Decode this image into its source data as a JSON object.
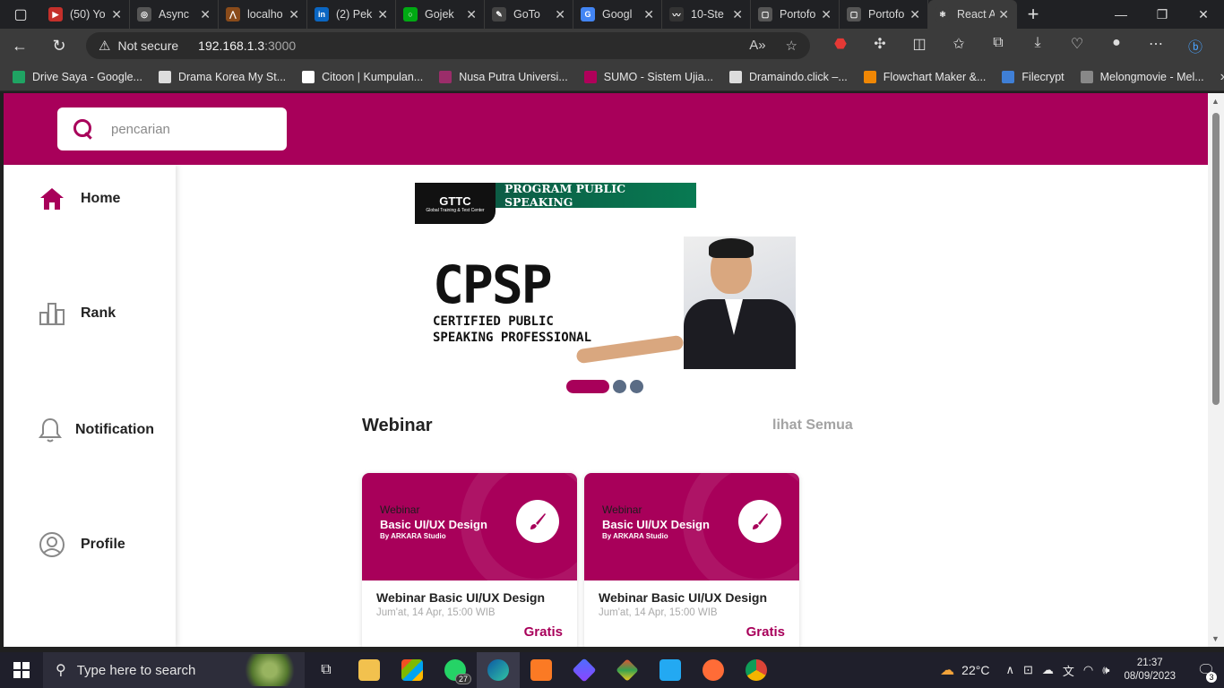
{
  "browser": {
    "tabs": [
      {
        "label": "(50) Yo",
        "icon": "youtube-icon",
        "color": "#c4302b",
        "glyph": "▶"
      },
      {
        "label": "Async",
        "icon": "openai-icon",
        "color": "#555",
        "glyph": "◎"
      },
      {
        "label": "localho",
        "icon": "xampp-icon",
        "color": "#8a4b1a",
        "glyph": "⋀"
      },
      {
        "label": "(2) Pek",
        "icon": "linkedin-icon",
        "color": "#0a66c2",
        "glyph": "in"
      },
      {
        "label": "Gojek",
        "icon": "gojek-icon",
        "color": "#00aa13",
        "glyph": "○"
      },
      {
        "label": "GoTo",
        "icon": "goto-icon",
        "color": "#444",
        "glyph": "✎"
      },
      {
        "label": "Googl",
        "icon": "google-translate-icon",
        "color": "#4285f4",
        "glyph": "G"
      },
      {
        "label": "10-Ste",
        "icon": "wave-icon",
        "color": "#333",
        "glyph": "〰"
      },
      {
        "label": "Portofo",
        "icon": "document-icon",
        "color": "#555",
        "glyph": "▢"
      },
      {
        "label": "Portofo",
        "icon": "document-icon",
        "color": "#555",
        "glyph": "▢"
      },
      {
        "label": "React A",
        "icon": "react-icon",
        "color": "#3b3b3b",
        "glyph": "⚛"
      }
    ],
    "address": {
      "security_label": "Not secure",
      "host": "192.168.1.3",
      "port": ":3000"
    },
    "bookmarks": [
      {
        "label": "Drive Saya - Google...",
        "color": "#1fa463"
      },
      {
        "label": "Drama Korea My St...",
        "color": "#ddd"
      },
      {
        "label": "Citoon | Kumpulan...",
        "color": "#fff"
      },
      {
        "label": "Nusa Putra Universi...",
        "color": "#9b2d6a"
      },
      {
        "label": "SUMO - Sistem Ujia...",
        "color": "#b0005a"
      },
      {
        "label": "Dramaindo.click –...",
        "color": "#ddd"
      },
      {
        "label": "Flowchart Maker &...",
        "color": "#f08705"
      },
      {
        "label": "Filecrypt",
        "color": "#3f7fd6"
      },
      {
        "label": "Melongmovie - Mel...",
        "color": "#888"
      }
    ]
  },
  "app": {
    "search_placeholder": "pencarian",
    "brand_color": "#a8005a",
    "nav": [
      {
        "label": "Home",
        "icon": "home-icon"
      },
      {
        "label": "Rank",
        "icon": "rank-chart-icon"
      },
      {
        "label": "Notification",
        "icon": "bell-icon"
      },
      {
        "label": "Profile",
        "icon": "user-profile-icon"
      }
    ],
    "banner": {
      "logo": "GTTC",
      "logo_sub": "Global Training & Test Center",
      "program": "PROGRAM PUBLIC SPEAKING",
      "title": "CPSP",
      "subtitle_line1": "CERTIFIED PUBLIC",
      "subtitle_line2": "SPEAKING PROFESSIONAL",
      "slides": 3,
      "active_slide": 1
    },
    "section": {
      "title": "Webinar",
      "see_all": "lihat Semua"
    },
    "cards": [
      {
        "kicker": "Webinar",
        "cover_title": "Basic UI/UX Design",
        "cover_by": "By ARKARA Studio",
        "title": "Webinar Basic UI/UX Design",
        "date": "Jum'at, 14 Apr, 15:00 WIB",
        "price": "Gratis"
      },
      {
        "kicker": "Webinar",
        "cover_title": "Basic UI/UX Design",
        "cover_by": "By ARKARA Studio",
        "title": "Webinar Basic UI/UX Design",
        "date": "Jum'at, 14 Apr, 15:00 WIB",
        "price": "Gratis"
      }
    ]
  },
  "taskbar": {
    "search_placeholder": "Type here to search",
    "whatsapp_badge": "27",
    "temperature": "22°C",
    "time": "21:37",
    "date": "08/09/2023",
    "notifications": "3"
  }
}
